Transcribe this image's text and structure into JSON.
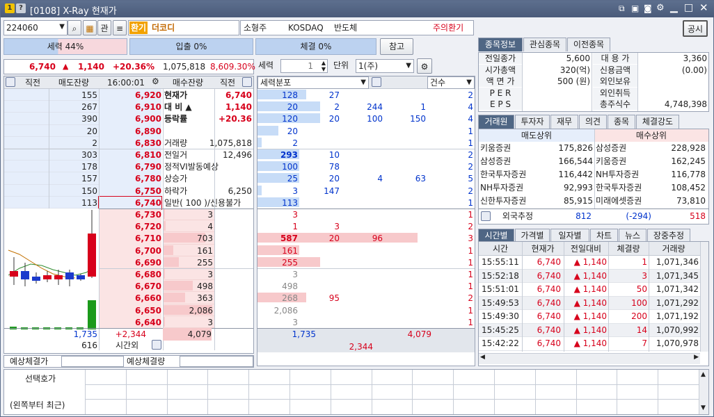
{
  "title": {
    "badges": [
      "1",
      "?"
    ],
    "text": "[0108] X-Ray 현재가"
  },
  "toolbar": {
    "code": "224060",
    "gwan": "관",
    "hwangi": "환기",
    "name": "더코디",
    "type": "소형주",
    "market": "KOSDAQ",
    "sector": "반도체",
    "warning": "주의환기",
    "gongsi": "공시"
  },
  "stats": {
    "seryeok": "세력 44%",
    "ipchul": "입출 0%",
    "chegyeol": "체결 0%",
    "chamgo": "참고"
  },
  "price": {
    "current": "6,740",
    "change": "1,140",
    "rate": "+20.36%",
    "volume": "1,075,818",
    "pct": "8,609.30%"
  },
  "orderbook": {
    "headers": [
      "직전",
      "매도잔량",
      "16:00:01",
      "매수잔량",
      "직전"
    ],
    "sell": [
      [
        "155",
        "6,920"
      ],
      [
        "267",
        "6,910"
      ],
      [
        "390",
        "6,900"
      ],
      [
        "20",
        "6,890"
      ],
      [
        "2",
        "6,830"
      ],
      [
        "303",
        "6,810"
      ],
      [
        "178",
        "6,790"
      ],
      [
        "157",
        "6,780"
      ],
      [
        "150",
        "6,750"
      ],
      [
        "113",
        "6,740"
      ]
    ],
    "buy": [
      [
        "6,730",
        "3"
      ],
      [
        "6,720",
        "4"
      ],
      [
        "6,710",
        "703"
      ],
      [
        "6,700",
        "161"
      ],
      [
        "6,690",
        "255"
      ],
      [
        "6,680",
        "3"
      ],
      [
        "6,670",
        "498"
      ],
      [
        "6,660",
        "363"
      ],
      [
        "6,650",
        "2,086"
      ],
      [
        "6,640",
        "3"
      ]
    ],
    "info": [
      [
        "현재가",
        "6,740"
      ],
      [
        "대 비 ▲",
        "1,140"
      ],
      [
        "등락률",
        "+20.36"
      ],
      [
        "",
        ""
      ],
      [
        "거래량",
        "1,075,818"
      ],
      [
        "전일거",
        "12,496"
      ],
      [
        "정적VI발동예상",
        ""
      ],
      [
        "상승가",
        ""
      ],
      [
        "하락가",
        "6,250"
      ],
      [
        "일반( 100 )/신용불가",
        ""
      ]
    ],
    "total_sell": "1,735",
    "total_diff": "+2,344",
    "total_buy": "4,079",
    "bottom_left": "616",
    "sigan": "시간외",
    "yesang1": "예상체결가",
    "yesang2": "예상체결량"
  },
  "dist": {
    "label1": "세력",
    "qty": "1",
    "label2": "단위",
    "unit": "1(주)",
    "header": "세력분포",
    "count_header": "건수",
    "rows": [
      [
        "128",
        "27",
        "",
        "",
        "2"
      ],
      [
        "20",
        "2",
        "244",
        "1",
        "4"
      ],
      [
        "120",
        "20",
        "100",
        "150",
        "4"
      ],
      [
        "20",
        "",
        "",
        "",
        "1"
      ],
      [
        "2",
        "",
        "",
        "",
        "1"
      ],
      [
        "293",
        "10",
        "",
        "",
        "2"
      ],
      [
        "100",
        "78",
        "",
        "",
        "2"
      ],
      [
        "25",
        "20",
        "4",
        "63",
        "5"
      ],
      [
        "3",
        "147",
        "",
        "",
        "2"
      ],
      [
        "113",
        "",
        "",
        "",
        "1"
      ],
      [
        "3",
        "",
        "",
        "",
        "1"
      ],
      [
        "1",
        "3",
        "",
        "",
        "2"
      ],
      [
        "587",
        "20",
        "96",
        "",
        "3"
      ],
      [
        "161",
        "",
        "",
        "",
        "1"
      ],
      [
        "255",
        "",
        "",
        "",
        "1"
      ],
      [
        "3",
        "",
        "",
        "",
        "1"
      ],
      [
        "498",
        "",
        "",
        "",
        "1"
      ],
      [
        "268",
        "95",
        "",
        "",
        "2"
      ],
      [
        "2,086",
        "",
        "",
        "",
        "1"
      ],
      [
        "3",
        "",
        "",
        "",
        "1"
      ]
    ],
    "sum1": "1,735",
    "sum2": "4,079",
    "sum3": "2,344"
  },
  "info": {
    "tabs": [
      "종목정보",
      "관심종목",
      "이전종목"
    ],
    "rows": [
      [
        "전일종가",
        "5,600",
        "대 용 가",
        "3,360"
      ],
      [
        "시가총액",
        "320(억)",
        "신용금액",
        "(0.00)"
      ],
      [
        "액 면 가",
        "500 (원)",
        "외인보유",
        ""
      ],
      [
        "P E R",
        "",
        "외인취득",
        ""
      ],
      [
        "E P S",
        "",
        "총주식수",
        "4,748,398"
      ]
    ]
  },
  "broker": {
    "tabs": [
      "거래원",
      "투자자",
      "재무",
      "의견",
      "종목",
      "체결강도"
    ],
    "sell_header": "매도상위",
    "buy_header": "매수상위",
    "rows": [
      [
        "키움증권",
        "175,826",
        "삼성증권",
        "228,928"
      ],
      [
        "삼성증권",
        "166,544",
        "키움증권",
        "162,245"
      ],
      [
        "한국투자증권",
        "116,442",
        "NH투자증권",
        "116,778"
      ],
      [
        "NH투자증권",
        "92,993",
        "한국투자증권",
        "108,452"
      ],
      [
        "신한투자증권",
        "85,915",
        "미래에셋증권",
        "73,810"
      ]
    ],
    "foreign": [
      "외국추정",
      "812",
      "(-294)",
      "518"
    ]
  },
  "ticks": {
    "tabs": [
      "시간별",
      "가격별",
      "일자별",
      "차트",
      "뉴스",
      "장중추정"
    ],
    "headers": [
      "시간",
      "현재가",
      "전일대비",
      "체결량",
      "거래량"
    ],
    "rows": [
      [
        "15:55:11",
        "6,740",
        "▲ 1,140",
        "1",
        "1,071,346"
      ],
      [
        "15:52:18",
        "6,740",
        "▲ 1,140",
        "3",
        "1,071,345"
      ],
      [
        "15:51:01",
        "6,740",
        "▲ 1,140",
        "50",
        "1,071,342"
      ],
      [
        "15:49:53",
        "6,740",
        "▲ 1,140",
        "100",
        "1,071,292"
      ],
      [
        "15:49:30",
        "6,740",
        "▲ 1,140",
        "200",
        "1,071,192"
      ],
      [
        "15:45:25",
        "6,740",
        "▲ 1,140",
        "14",
        "1,070,992"
      ],
      [
        "15:42:22",
        "6,740",
        "▲ 1,140",
        "7",
        "1,070,978"
      ]
    ]
  },
  "bottom": {
    "label1": "선택호가",
    "label2": "(왼쪽부터 최근)"
  }
}
